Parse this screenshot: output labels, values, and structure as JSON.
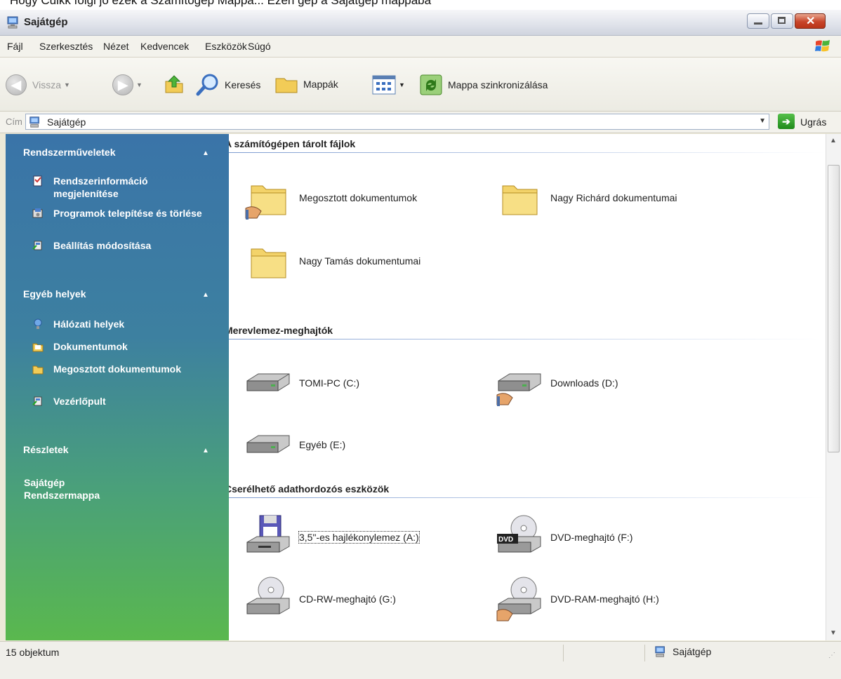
{
  "caption": "Hogy Cuikk fölgi jó ezek a Számítógép Mappa... Ezen gép a Sajátgép mappába",
  "window": {
    "title": "Sajátgép"
  },
  "menu": [
    "Fájl",
    "Szerkesztés",
    "Nézet",
    "Kedvencek",
    "Eszközök",
    "Súgó"
  ],
  "toolbar": {
    "back": "Vissza",
    "search": "Keresés",
    "folders": "Mappák",
    "sync": "Mappa szinkronizálása"
  },
  "address": {
    "label": "Cím",
    "value": "Sajátgép",
    "go": "Ugrás"
  },
  "sidebar": {
    "system_tasks": {
      "title": "Rendszerműveletek",
      "items": [
        {
          "label": "Rendszerinformáció megjelenítése",
          "icon": "system-info-icon"
        },
        {
          "label": "Programok telepítése és törlése",
          "icon": "add-remove-programs-icon"
        },
        {
          "label": "Beállítás módosítása",
          "icon": "control-panel-icon"
        }
      ]
    },
    "other_places": {
      "title": "Egyéb helyek",
      "items": [
        {
          "label": "Hálózati helyek",
          "icon": "network-places-icon"
        },
        {
          "label": "Dokumentumok",
          "icon": "documents-icon"
        },
        {
          "label": "Megosztott dokumentumok",
          "icon": "shared-folder-icon"
        },
        {
          "label": "Vezérlőpult",
          "icon": "control-panel-icon"
        }
      ]
    },
    "details": {
      "title": "Részletek",
      "name": "Sajátgép",
      "type": "Rendszermappa"
    }
  },
  "groups": {
    "files": {
      "title": "A számítógépen tárolt fájlok",
      "items": [
        "Megosztott dokumentumok",
        "Nagy Richárd dokumentumai",
        "Nagy Tamás dokumentumai"
      ]
    },
    "hdd": {
      "title": "Merevlemez-meghajtók",
      "items": [
        "TOMI-PC (C:)",
        "Downloads (D:)",
        "Egyéb (E:)"
      ]
    },
    "removable": {
      "title": "Cserélhető adathordozós eszközök",
      "items": [
        "3,5\"-es hajlékonylemez (A:)",
        "DVD-meghajtó (F:)",
        "CD-RW-meghajtó (G:)",
        "DVD-RAM-meghajtó (H:)"
      ]
    }
  },
  "status": {
    "count": "15 objektum",
    "location": "Sajátgép"
  },
  "colors": {
    "sidebar_top": "#3a74a8",
    "sidebar_bottom": "#5ab84e",
    "folder": "#f3d36a"
  }
}
